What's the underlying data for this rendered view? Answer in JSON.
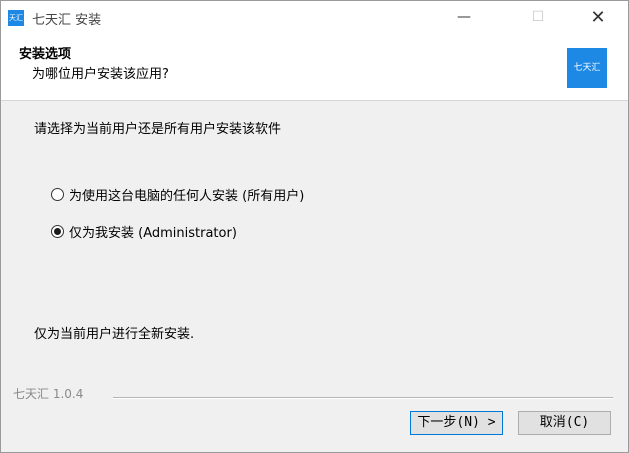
{
  "window": {
    "title": "七天汇 安装",
    "app_icon_text": "天汇"
  },
  "titlebar": {
    "minimize": "—",
    "maximize": "☐",
    "close": "✕"
  },
  "header": {
    "title": "安装选项",
    "subtitle": "为哪位用户安装该应用?",
    "logo_text": "七天汇"
  },
  "body": {
    "prompt": "请选择为当前用户还是所有用户安装该软件",
    "options": [
      {
        "label": "为使用这台电脑的任何人安装 (所有用户)",
        "checked": false
      },
      {
        "label": "仅为我安装 (Administrator)",
        "checked": true
      }
    ],
    "description": "仅为当前用户进行全新安装."
  },
  "footer": {
    "brand": "七天汇 1.0.4",
    "next_label": "下一步(N) >",
    "cancel_label": "取消(C)"
  },
  "colors": {
    "accent": "#1e88e5",
    "focus_border": "#0078d7",
    "body_bg": "#f0f0f0"
  }
}
